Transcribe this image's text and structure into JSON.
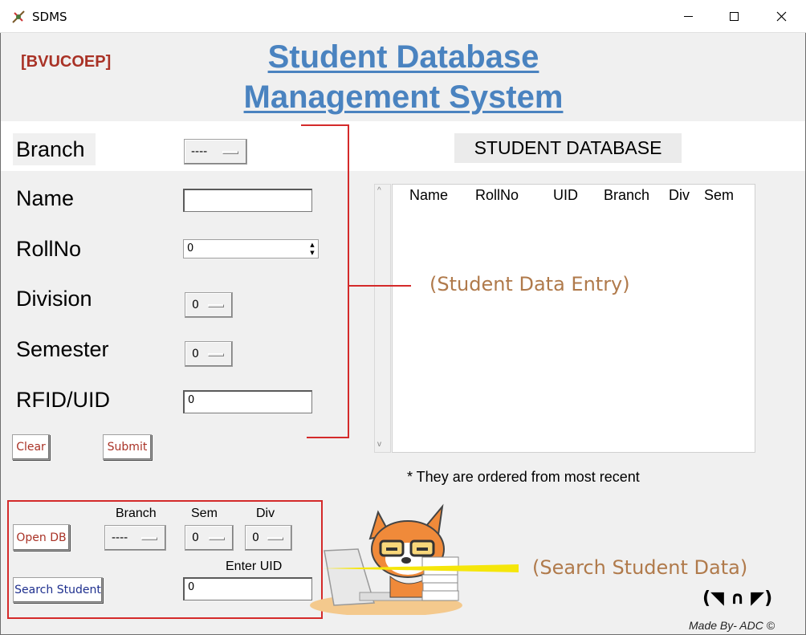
{
  "window": {
    "title": "SDMS"
  },
  "header": {
    "college": "[BVUCOEP]",
    "title_line1": "Student Database",
    "title_line2": "Management System"
  },
  "form": {
    "branch_label": "Branch",
    "branch_value": "----",
    "name_label": "Name",
    "name_value": "",
    "rollno_label": "RollNo",
    "rollno_value": "0",
    "division_label": "Division",
    "division_value": "0",
    "semester_label": "Semester",
    "semester_value": "0",
    "uid_label": "RFID/UID",
    "uid_value": "0",
    "clear_label": "Clear",
    "submit_label": "Submit"
  },
  "database": {
    "title": "STUDENT DATABASE",
    "columns": [
      "Name",
      "RollNo",
      "UID",
      "Branch",
      "Div",
      "Sem"
    ],
    "note": "* They are ordered from most recent"
  },
  "search": {
    "open_db_label": "Open DB",
    "branch_label": "Branch",
    "branch_value": "----",
    "sem_label": "Sem",
    "sem_value": "0",
    "div_label": "Div",
    "div_value": "0",
    "uid_label": "Enter UID",
    "uid_value": "0",
    "search_label": "Search Student"
  },
  "annotations": {
    "entry": "(Student Data Entry)",
    "search": "(Search Student Data)"
  },
  "footer": {
    "emoticon": "(◥ ∩ ◤)",
    "credit": "Made By- ADC ©"
  },
  "colors": {
    "title_blue": "#4a83c0",
    "college_red": "#a93226",
    "annotation_red": "#d42a2a",
    "annotation_text": "#b07a4b",
    "highlight_yellow": "#f5e60a"
  }
}
